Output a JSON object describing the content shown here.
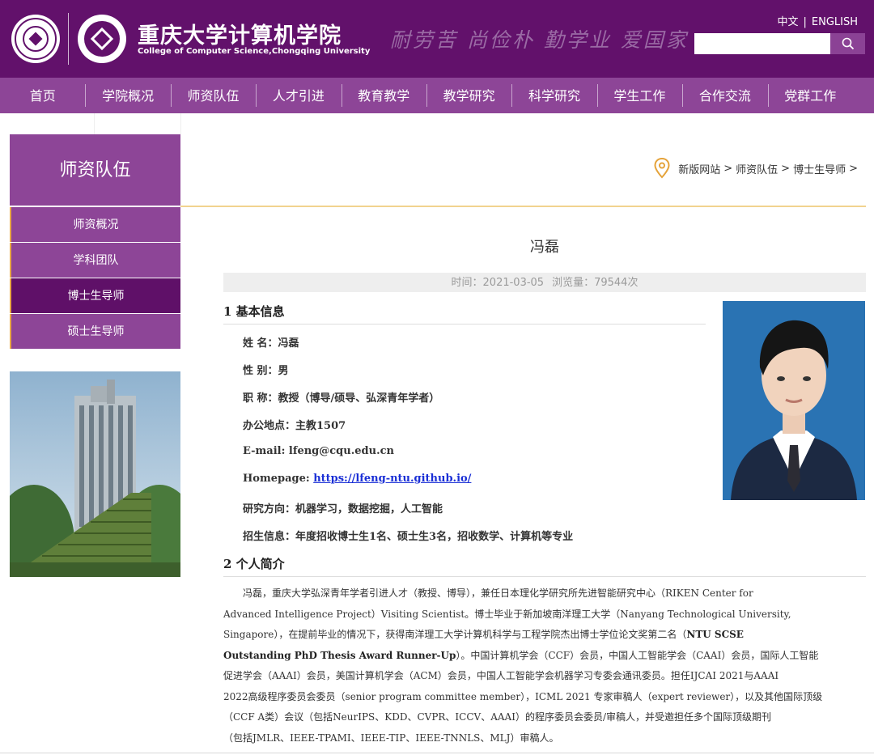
{
  "header": {
    "title_cn": "重庆大学计算机学院",
    "title_en": "College of Computer Science,Chongqing University",
    "motto": "耐劳苦 尚俭朴 勤学业 爱国家",
    "lang_cn": "中文",
    "lang_sep": "|",
    "lang_en": "ENGLISH",
    "search_placeholder": ""
  },
  "nav": [
    "首页",
    "学院概况",
    "师资队伍",
    "人才引进",
    "教育教学",
    "教学研究",
    "科学研究",
    "学生工作",
    "合作交流",
    "党群工作"
  ],
  "sidebar": {
    "heading": "师资队伍",
    "items": [
      {
        "label": "师资概况",
        "active": false
      },
      {
        "label": "学科团队",
        "active": false
      },
      {
        "label": "博士生导师",
        "active": true
      },
      {
        "label": "硕士生导师",
        "active": false
      }
    ]
  },
  "breadcrumb": [
    "新版网站",
    "师资队伍",
    "博士生导师"
  ],
  "breadcrumb_sep": ">",
  "article": {
    "title": "冯磊",
    "time": "时间：2021-03-05",
    "views": "浏览量：79544次",
    "section1": "1 基本信息",
    "info": [
      "姓 名：冯磊",
      "性 别：男",
      "职 称：教授（博导/硕导、弘深青年学者）",
      "办公地点：主教1507",
      "E-mail: lfeng@cqu.edu.cn"
    ],
    "homepage_label": "Homepage:",
    "homepage_url": "https://lfeng-ntu.github.io/",
    "info_after": [
      "研究方向：机器学习，数据挖掘，人工智能",
      "招生信息：年度招收博士生1名、硕士生3名，招收数学、计算机等专业"
    ],
    "section2": "2 个人简介",
    "bio": {
      "line1": "冯磊，重庆大学弘深青年学者引进人才（教授、博导），兼任日本理化学研究所先进智能研究中心（RIKEN Center for",
      "line2": "Advanced Intelligence Project）Visiting Scientist。博士毕业于新加坡南洋理工大学（Nanyang Technological University,",
      "line3a": "Singapore），在提前毕业的情况下，获得南洋理工大学计算机科学与工程学院杰出博士学位论文奖第二名（",
      "line3b": "NTU SCSE",
      "line4a": "Outstanding PhD Thesis Award Runner-Up",
      "line4b": "）。中国计算机学会（CCF）会员，中国人工智能学会（CAAI）会员，国际人工智能",
      "line5": "促进学会（AAAI）会员，美国计算机学会（ACM）会员，中国人工智能学会机器学习专委会通讯委员。担任IJCAI 2021与AAAI",
      "line6": "2022高级程序委员会委员（senior program committee member），ICML 2021 专家审稿人（expert reviewer），以及其他国际顶级",
      "line7": "（CCF A类）会议（包括NeurIPS、KDD、CVPR、ICCV、AAAI）的程序委员会委员/审稿人，并受邀担任多个国际顶级期刊",
      "line8": "（包括JMLR、IEEE-TPAMI、IEEE-TIP、IEEE-TNNLS、MLJ）审稿人。"
    }
  },
  "colors": {
    "header_bg": "#62116b",
    "nav_bg": "#8d4597",
    "active_bg": "#5f1068",
    "accent": "#e9a945",
    "link": "#1a2fd6"
  },
  "icons": [
    "university-seal-icon",
    "college-emblem-icon",
    "search-icon",
    "location-pin-icon"
  ]
}
